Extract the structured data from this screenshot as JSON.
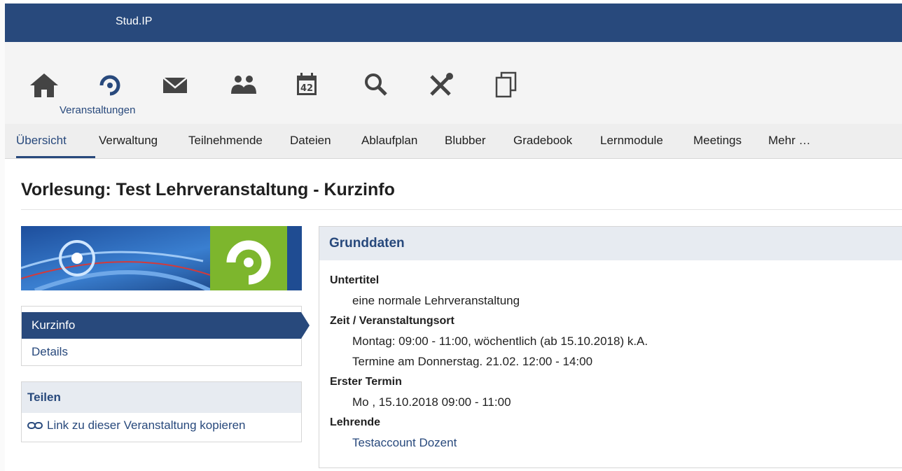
{
  "app": {
    "brand": "Stud.IP"
  },
  "colors": {
    "primary": "#28497c",
    "accent_green": "#7db62d",
    "header_bg": "#e7ebf1"
  },
  "icon_nav": {
    "items": [
      {
        "name": "home-icon"
      },
      {
        "name": "courses-icon"
      },
      {
        "name": "messages-icon"
      },
      {
        "name": "community-icon"
      },
      {
        "name": "calendar-icon"
      },
      {
        "name": "search-icon"
      },
      {
        "name": "tools-icon"
      },
      {
        "name": "documents-icon"
      }
    ],
    "active_label": "Veranstaltungen",
    "calendar_number": "42"
  },
  "tabs": [
    "Übersicht",
    "Verwaltung",
    "Teilnehmende",
    "Dateien",
    "Ablaufplan",
    "Blubber",
    "Gradebook",
    "Lernmodule",
    "Meetings",
    "Mehr …"
  ],
  "page": {
    "title": "Vorlesung: Test Lehrveranstaltung - Kurzinfo"
  },
  "sidenav": {
    "items": [
      "Kurzinfo",
      "Details"
    ]
  },
  "share": {
    "title": "Teilen",
    "link_label": "Link zu dieser Veranstaltung kopieren",
    "link_icon": "link-icon"
  },
  "info": {
    "title": "Grunddaten",
    "subtitle_label": "Untertitel",
    "subtitle_value": "eine normale Lehrveranstaltung",
    "time_label": "Zeit / Veranstaltungsort",
    "time_values": [
      "Montag: 09:00 - 11:00, wöchentlich (ab 15.10.2018) k.A.",
      "Termine am Donnerstag. 21.02. 12:00 - 14:00"
    ],
    "first_label": "Erster Termin",
    "first_value": "Mo , 15.10.2018 09:00 - 11:00",
    "teachers_label": "Lehrende",
    "teacher": "Testaccount Dozent"
  }
}
